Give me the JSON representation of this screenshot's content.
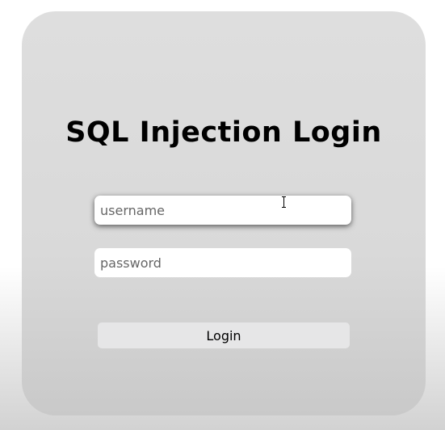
{
  "title": "SQL Injection Login",
  "username": {
    "placeholder": "username",
    "value": ""
  },
  "password": {
    "placeholder": "password",
    "value": ""
  },
  "login_label": "Login"
}
